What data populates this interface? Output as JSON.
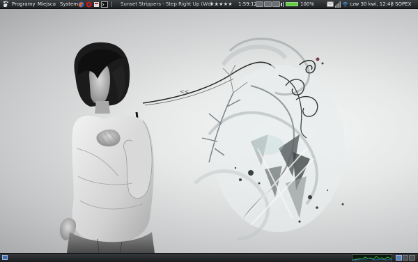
{
  "top_panel": {
    "menus": {
      "applications": "Programy",
      "places": "Miejsca",
      "system": "System"
    },
    "now_playing": "Sunset Strippers - Step Right Up (Wdl ...",
    "rating": "★★★★★",
    "time_elapsed": "1:59:12",
    "battery_percent": "100%",
    "battery_level": 1.0,
    "clock": "czw 30 kwi, 12:48",
    "user": "SOPEX"
  },
  "colors": {
    "panel_bg": "#2a2d30",
    "panel_text": "#e8e8e8",
    "battery_green": "#5fce3a",
    "cpu_graph": "#3fae3f"
  },
  "icons": [
    "gnome-foot-icon",
    "firefox-icon",
    "opera-icon",
    "terminal-icon",
    "window-list-icon",
    "music-player-icon",
    "star-rating-icon",
    "playback-controls-icon",
    "volume-icon",
    "battery-icon",
    "mail-icon",
    "network-icon",
    "wireless-icon",
    "show-desktop-icon",
    "cpu-monitor-icon",
    "workspace-switcher-icon"
  ]
}
